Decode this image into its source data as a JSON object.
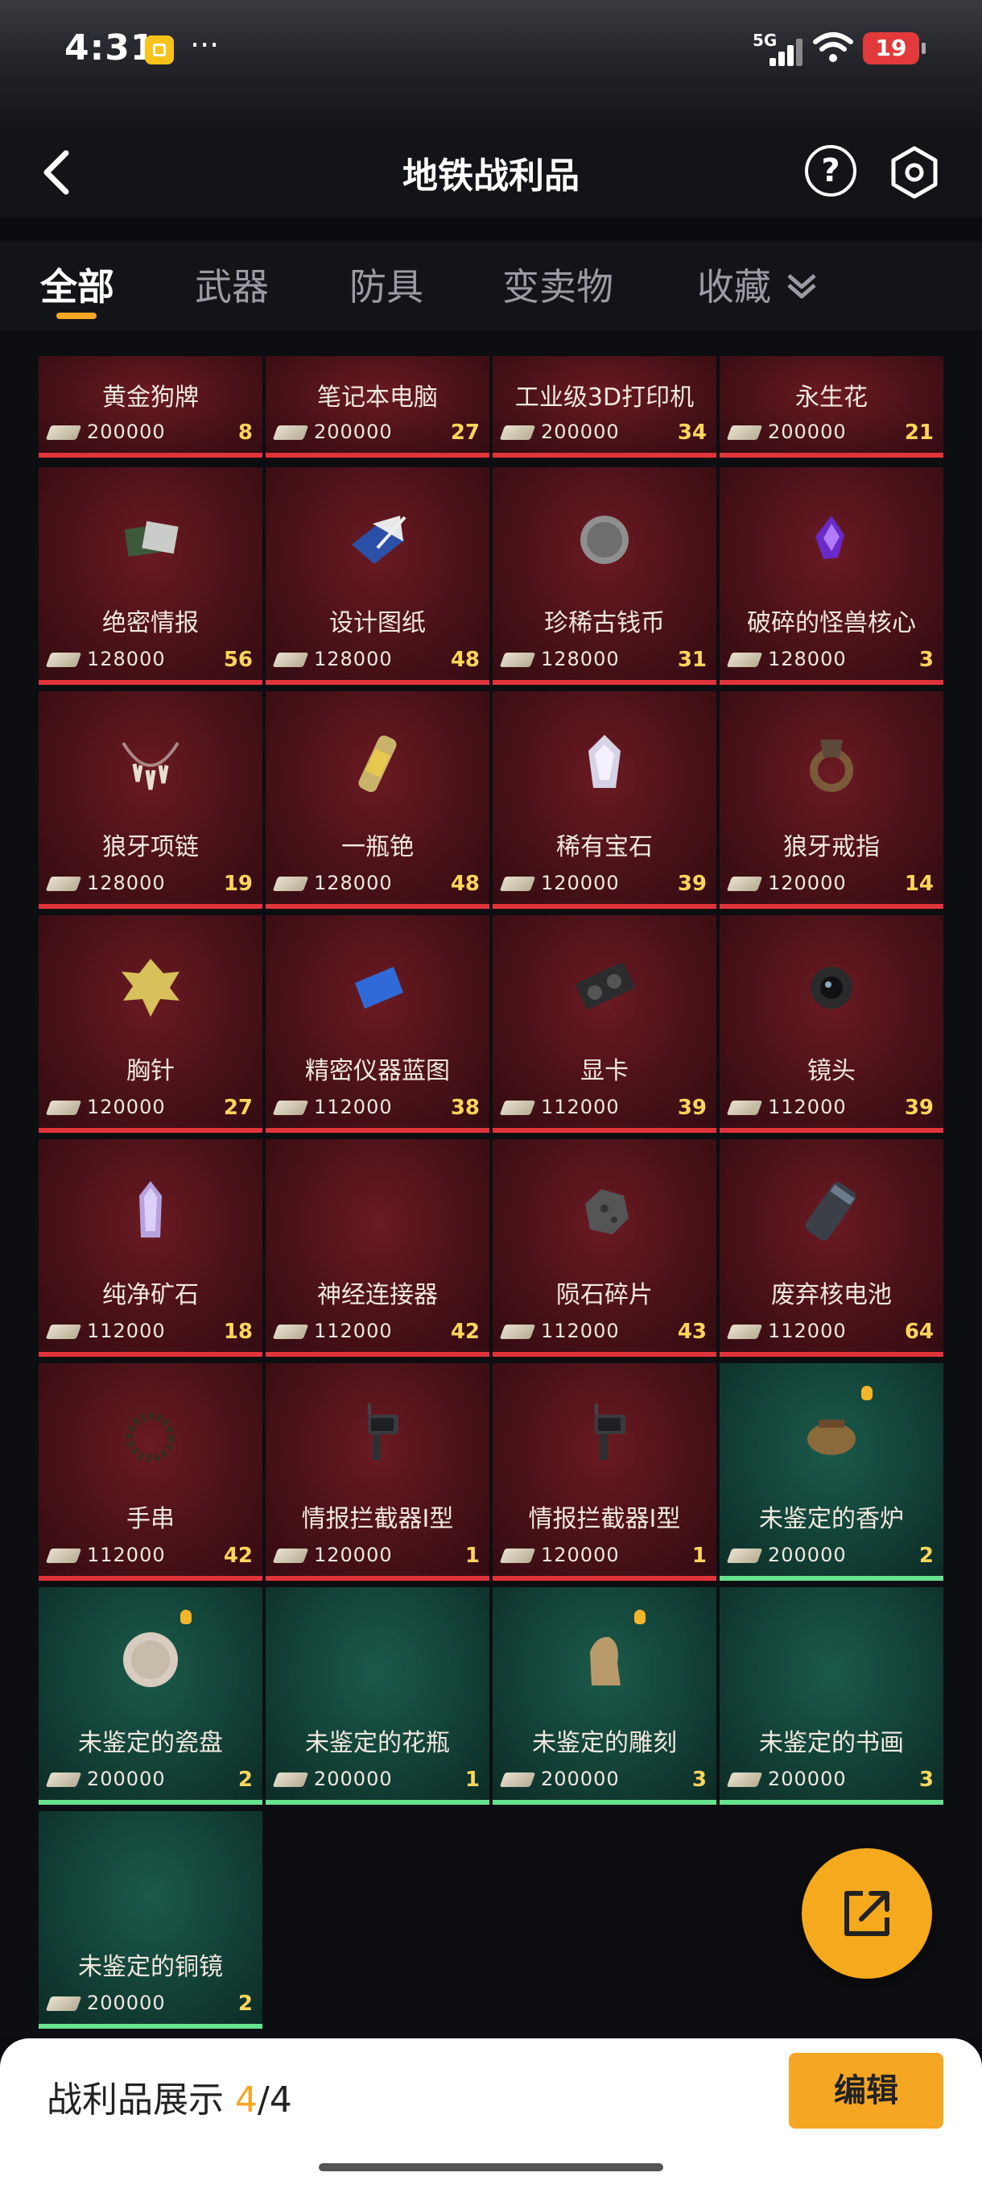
{
  "status_bar": {
    "time": "4:31",
    "dots": "···",
    "network": "5G",
    "battery": "19"
  },
  "header": {
    "title": "地铁战利品"
  },
  "tabs": [
    {
      "label": "全部",
      "active": true
    },
    {
      "label": "武器",
      "active": false
    },
    {
      "label": "防具",
      "active": false
    },
    {
      "label": "变卖物",
      "active": false
    },
    {
      "label": "收藏",
      "active": false
    }
  ],
  "items": [
    {
      "name": "黄金狗牌",
      "price": "200000",
      "qty": "8",
      "rarity": "red",
      "icon": "dog-tag-icon"
    },
    {
      "name": "笔记本电脑",
      "price": "200000",
      "qty": "27",
      "rarity": "red",
      "icon": "laptop-icon"
    },
    {
      "name": "工业级3D打印机",
      "price": "200000",
      "qty": "34",
      "rarity": "red",
      "icon": "printer-icon"
    },
    {
      "name": "永生花",
      "price": "200000",
      "qty": "21",
      "rarity": "red",
      "icon": "flower-icon"
    },
    {
      "name": "绝密情报",
      "price": "128000",
      "qty": "56",
      "rarity": "red",
      "icon": "documents-icon"
    },
    {
      "name": "设计图纸",
      "price": "128000",
      "qty": "48",
      "rarity": "red",
      "icon": "blueprint-icon"
    },
    {
      "name": "珍稀古钱币",
      "price": "128000",
      "qty": "31",
      "rarity": "red",
      "icon": "coin-icon"
    },
    {
      "name": "破碎的怪兽核心",
      "price": "128000",
      "qty": "3",
      "rarity": "red",
      "icon": "crystal-core-icon"
    },
    {
      "name": "狼牙项链",
      "price": "128000",
      "qty": "19",
      "rarity": "red",
      "icon": "necklace-icon"
    },
    {
      "name": "一瓶铯",
      "price": "128000",
      "qty": "48",
      "rarity": "red",
      "icon": "vial-icon"
    },
    {
      "name": "稀有宝石",
      "price": "120000",
      "qty": "39",
      "rarity": "red",
      "icon": "gem-icon"
    },
    {
      "name": "狼牙戒指",
      "price": "120000",
      "qty": "14",
      "rarity": "red",
      "icon": "ring-icon"
    },
    {
      "name": "胸针",
      "price": "120000",
      "qty": "27",
      "rarity": "red",
      "icon": "leaf-brooch-icon"
    },
    {
      "name": "精密仪器蓝图",
      "price": "112000",
      "qty": "38",
      "rarity": "red",
      "icon": "blue-sheet-icon"
    },
    {
      "name": "显卡",
      "price": "112000",
      "qty": "39",
      "rarity": "red",
      "icon": "gpu-icon"
    },
    {
      "name": "镜头",
      "price": "112000",
      "qty": "39",
      "rarity": "red",
      "icon": "lens-icon"
    },
    {
      "name": "纯净矿石",
      "price": "112000",
      "qty": "18",
      "rarity": "red",
      "icon": "purple-crystal-icon"
    },
    {
      "name": "神经连接器",
      "price": "112000",
      "qty": "42",
      "rarity": "red",
      "icon": "connector-icon"
    },
    {
      "name": "陨石碎片",
      "price": "112000",
      "qty": "43",
      "rarity": "red",
      "icon": "meteorite-icon"
    },
    {
      "name": "废弃核电池",
      "price": "112000",
      "qty": "64",
      "rarity": "red",
      "icon": "battery-cell-icon"
    },
    {
      "name": "手串",
      "price": "112000",
      "qty": "42",
      "rarity": "red",
      "icon": "bracelet-icon"
    },
    {
      "name": "情报拦截器I型",
      "price": "120000",
      "qty": "1",
      "rarity": "red",
      "icon": "interceptor-icon"
    },
    {
      "name": "情报拦截器I型",
      "price": "120000",
      "qty": "1",
      "rarity": "red",
      "icon": "interceptor-icon"
    },
    {
      "name": "未鉴定的香炉",
      "price": "200000",
      "qty": "2",
      "rarity": "green",
      "icon": "incense-burner-icon",
      "badge": true
    },
    {
      "name": "未鉴定的瓷盘",
      "price": "200000",
      "qty": "2",
      "rarity": "green",
      "icon": "porcelain-plate-icon",
      "badge": true
    },
    {
      "name": "未鉴定的花瓶",
      "price": "200000",
      "qty": "1",
      "rarity": "green",
      "icon": "vase-icon"
    },
    {
      "name": "未鉴定的雕刻",
      "price": "200000",
      "qty": "3",
      "rarity": "green",
      "icon": "carving-icon",
      "badge": true
    },
    {
      "name": "未鉴定的书画",
      "price": "200000",
      "qty": "3",
      "rarity": "green",
      "icon": "painting-icon"
    },
    {
      "name": "未鉴定的铜镜",
      "price": "200000",
      "qty": "2",
      "rarity": "green",
      "icon": "bronze-mirror-icon"
    }
  ],
  "footer": {
    "label": "战利品展示",
    "current": "4",
    "total": "/4",
    "edit_label": "编辑"
  },
  "colors": {
    "accent": "#f5a623",
    "red_card": "#4a1118",
    "green_card": "#123f35",
    "qty": "#ffd65a"
  }
}
